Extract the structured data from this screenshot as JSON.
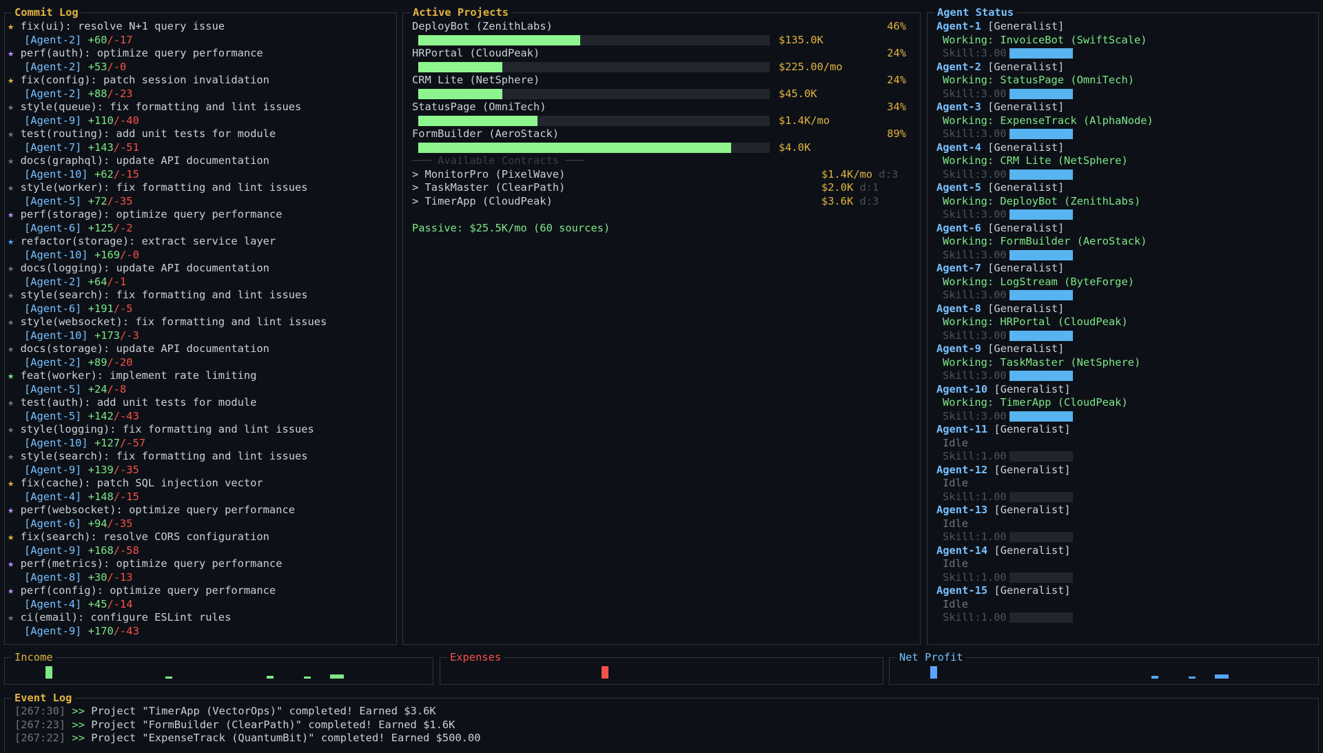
{
  "commit_log": {
    "title": "Commit Log",
    "items": [
      {
        "star": "★",
        "star_color": "yellow",
        "msg": "fix(ui): resolve N+1 query issue",
        "agent": "[Agent-2]",
        "add": "+60",
        "del": "/-17"
      },
      {
        "star": "★",
        "star_color": "purple",
        "msg": "perf(auth): optimize query performance",
        "agent": "[Agent-2]",
        "add": "+53",
        "del": "/-0"
      },
      {
        "star": "★",
        "star_color": "yellow",
        "msg": "fix(config): patch session invalidation",
        "agent": "[Agent-2]",
        "add": "+88",
        "del": "/-23"
      },
      {
        "star": "★",
        "star_color": "gray",
        "msg": "style(queue): fix formatting and lint issues",
        "agent": "[Agent-9]",
        "add": "+110",
        "del": "/-40"
      },
      {
        "star": "★",
        "star_color": "gray",
        "msg": "test(routing): add unit tests for module",
        "agent": "[Agent-7]",
        "add": "+143",
        "del": "/-51"
      },
      {
        "star": "★",
        "star_color": "gray",
        "msg": "docs(graphql): update API documentation",
        "agent": "[Agent-10]",
        "add": "+62",
        "del": "/-15"
      },
      {
        "star": "★",
        "star_color": "gray",
        "msg": "style(worker): fix formatting and lint issues",
        "agent": "[Agent-5]",
        "add": "+72",
        "del": "/-35"
      },
      {
        "star": "★",
        "star_color": "purple",
        "msg": "perf(storage): optimize query performance",
        "agent": "[Agent-6]",
        "add": "+125",
        "del": "/-2"
      },
      {
        "star": "★",
        "star_color": "blue",
        "msg": "refactor(storage): extract service layer",
        "agent": "[Agent-10]",
        "add": "+169",
        "del": "/-0"
      },
      {
        "star": "★",
        "star_color": "gray",
        "msg": "docs(logging): update API documentation",
        "agent": "[Agent-2]",
        "add": "+64",
        "del": "/-1"
      },
      {
        "star": "★",
        "star_color": "gray",
        "msg": "style(search): fix formatting and lint issues",
        "agent": "[Agent-6]",
        "add": "+191",
        "del": "/-5"
      },
      {
        "star": "★",
        "star_color": "gray",
        "msg": "style(websocket): fix formatting and lint issues",
        "agent": "[Agent-10]",
        "add": "+173",
        "del": "/-3"
      },
      {
        "star": "★",
        "star_color": "gray",
        "msg": "docs(storage): update API documentation",
        "agent": "[Agent-2]",
        "add": "+89",
        "del": "/-20"
      },
      {
        "star": "★",
        "star_color": "green",
        "msg": "feat(worker): implement rate limiting",
        "agent": "[Agent-5]",
        "add": "+24",
        "del": "/-8"
      },
      {
        "star": "★",
        "star_color": "gray",
        "msg": "test(auth): add unit tests for module",
        "agent": "[Agent-5]",
        "add": "+142",
        "del": "/-43"
      },
      {
        "star": "★",
        "star_color": "gray",
        "msg": "style(logging): fix formatting and lint issues",
        "agent": "[Agent-10]",
        "add": "+127",
        "del": "/-57"
      },
      {
        "star": "★",
        "star_color": "gray",
        "msg": "style(search): fix formatting and lint issues",
        "agent": "[Agent-9]",
        "add": "+139",
        "del": "/-35"
      },
      {
        "star": "★",
        "star_color": "yellow",
        "msg": "fix(cache): patch SQL injection vector",
        "agent": "[Agent-4]",
        "add": "+148",
        "del": "/-15"
      },
      {
        "star": "★",
        "star_color": "purple",
        "msg": "perf(websocket): optimize query performance",
        "agent": "[Agent-6]",
        "add": "+94",
        "del": "/-35"
      },
      {
        "star": "★",
        "star_color": "yellow",
        "msg": "fix(search): resolve CORS configuration",
        "agent": "[Agent-9]",
        "add": "+168",
        "del": "/-58"
      },
      {
        "star": "★",
        "star_color": "purple",
        "msg": "perf(metrics): optimize query performance",
        "agent": "[Agent-8]",
        "add": "+30",
        "del": "/-13"
      },
      {
        "star": "★",
        "star_color": "purple",
        "msg": "perf(config): optimize query performance",
        "agent": "[Agent-4]",
        "add": "+45",
        "del": "/-14"
      },
      {
        "star": "★",
        "star_color": "gray",
        "msg": "ci(email): configure ESLint rules",
        "agent": "[Agent-9]",
        "add": "+170",
        "del": "/-43"
      }
    ]
  },
  "projects": {
    "title": "Active Projects",
    "items": [
      {
        "name": "DeployBot (ZenithLabs)",
        "pct": "46%",
        "progress": 0.46,
        "value": "$135.0K"
      },
      {
        "name": "HRPortal (CloudPeak)",
        "pct": "24%",
        "progress": 0.24,
        "value": "$225.00/mo"
      },
      {
        "name": "CRM Lite (NetSphere)",
        "pct": "24%",
        "progress": 0.24,
        "value": "$45.0K"
      },
      {
        "name": "StatusPage (OmniTech)",
        "pct": "34%",
        "progress": 0.34,
        "value": "$1.4K/mo"
      },
      {
        "name": "FormBuilder (AeroStack)",
        "pct": "89%",
        "progress": 0.89,
        "value": "$4.0K"
      }
    ],
    "contracts_header": "─── Available Contracts ───",
    "contracts": [
      {
        "name": "> MonitorPro (PixelWave)",
        "price": "$1.4K/mo",
        "diff": "d:3"
      },
      {
        "name": "> TaskMaster (ClearPath)",
        "price": "$2.0K",
        "diff": "d:1"
      },
      {
        "name": "> TimerApp (CloudPeak)",
        "price": "$3.6K",
        "diff": "d:3"
      }
    ],
    "passive": "Passive: $25.5K/mo (60 sources)"
  },
  "agents": {
    "title": "Agent Status",
    "items": [
      {
        "name": "Agent-1",
        "role": "[Generalist]",
        "status": "Working: InvoiceBot (SwiftScale)",
        "working": true,
        "skill": "Skill:3.00",
        "skill_level": 1.0
      },
      {
        "name": "Agent-2",
        "role": "[Generalist]",
        "status": "Working: StatusPage (OmniTech)",
        "working": true,
        "skill": "Skill:3.00",
        "skill_level": 1.0
      },
      {
        "name": "Agent-3",
        "role": "[Generalist]",
        "status": "Working: ExpenseTrack (AlphaNode)",
        "working": true,
        "skill": "Skill:3.00",
        "skill_level": 1.0
      },
      {
        "name": "Agent-4",
        "role": "[Generalist]",
        "status": "Working: CRM Lite (NetSphere)",
        "working": true,
        "skill": "Skill:3.00",
        "skill_level": 1.0
      },
      {
        "name": "Agent-5",
        "role": "[Generalist]",
        "status": "Working: DeployBot (ZenithLabs)",
        "working": true,
        "skill": "Skill:3.00",
        "skill_level": 1.0
      },
      {
        "name": "Agent-6",
        "role": "[Generalist]",
        "status": "Working: FormBuilder (AeroStack)",
        "working": true,
        "skill": "Skill:3.00",
        "skill_level": 1.0
      },
      {
        "name": "Agent-7",
        "role": "[Generalist]",
        "status": "Working: LogStream (ByteForge)",
        "working": true,
        "skill": "Skill:3.00",
        "skill_level": 1.0
      },
      {
        "name": "Agent-8",
        "role": "[Generalist]",
        "status": "Working: HRPortal (CloudPeak)",
        "working": true,
        "skill": "Skill:3.00",
        "skill_level": 1.0
      },
      {
        "name": "Agent-9",
        "role": "[Generalist]",
        "status": "Working: TaskMaster (NetSphere)",
        "working": true,
        "skill": "Skill:3.00",
        "skill_level": 1.0
      },
      {
        "name": "Agent-10",
        "role": "[Generalist]",
        "status": "Working: TimerApp (CloudPeak)",
        "working": true,
        "skill": "Skill:3.00",
        "skill_level": 1.0
      },
      {
        "name": "Agent-11",
        "role": "[Generalist]",
        "status": "Idle",
        "working": false,
        "skill": "Skill:1.00",
        "skill_level": 0.0
      },
      {
        "name": "Agent-12",
        "role": "[Generalist]",
        "status": "Idle",
        "working": false,
        "skill": "Skill:1.00",
        "skill_level": 0.0
      },
      {
        "name": "Agent-13",
        "role": "[Generalist]",
        "status": "Idle",
        "working": false,
        "skill": "Skill:1.00",
        "skill_level": 0.0
      },
      {
        "name": "Agent-14",
        "role": "[Generalist]",
        "status": "Idle",
        "working": false,
        "skill": "Skill:1.00",
        "skill_level": 0.0
      },
      {
        "name": "Agent-15",
        "role": "[Generalist]",
        "status": "Idle",
        "working": false,
        "skill": "Skill:1.00",
        "skill_level": 0.0
      }
    ]
  },
  "income": {
    "title": "Income",
    "color": "#7ee787"
  },
  "expenses": {
    "title": "Expenses",
    "color": "#f85149"
  },
  "net_profit": {
    "title": "Net Profit",
    "color": "#58a6ff"
  },
  "event_log": {
    "title": "Event Log",
    "items": [
      {
        "time": "[267:30]",
        "arrow": ">>",
        "text": "Project \"TimerApp (VectorOps)\" completed! Earned $3.6K"
      },
      {
        "time": "[267:23]",
        "arrow": ">>",
        "text": "Project \"FormBuilder (ClearPath)\" completed! Earned $1.6K"
      },
      {
        "time": "[267:22]",
        "arrow": ">>",
        "text": "Project \"ExpenseTrack (QuantumBit)\" completed! Earned $500.00"
      }
    ]
  }
}
